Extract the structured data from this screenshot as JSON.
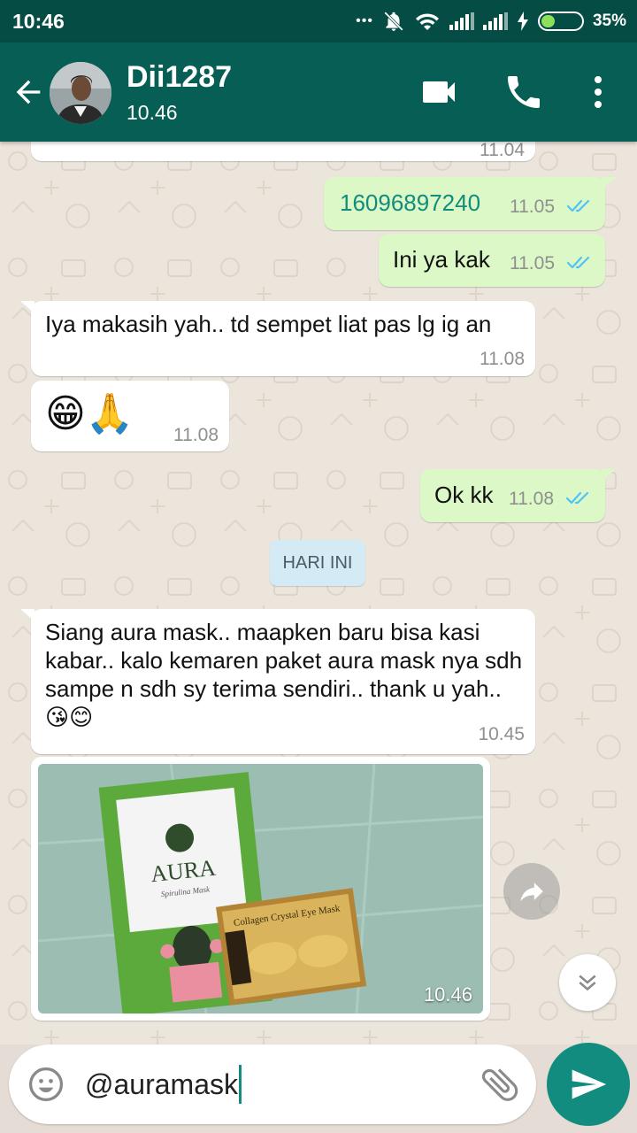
{
  "status_bar": {
    "time": "10:46",
    "dots": "•••",
    "battery_percent": "35%",
    "battery_level": 0.35
  },
  "header": {
    "contact_name": "Dii1287",
    "contact_status": "10.46",
    "icons": [
      "back-arrow-icon",
      "avatar",
      "video-call-icon",
      "phone-icon",
      "more-vert-icon"
    ]
  },
  "chat": {
    "partial_message_time": "11.04",
    "messages": [
      {
        "direction": "out",
        "text": "16096897240",
        "time": "11.05",
        "status": "read"
      },
      {
        "direction": "out",
        "text": "Ini ya kak",
        "time": "11.05",
        "status": "read"
      },
      {
        "direction": "in",
        "text": "Iya makasih yah.. td sempet liat pas lg ig an",
        "time": "11.08"
      },
      {
        "direction": "in",
        "text": "😁🙏",
        "time": "11.08"
      },
      {
        "direction": "out",
        "text": "Ok kk",
        "time": "11.08",
        "status": "read"
      },
      {
        "direction": "in",
        "text": "Siang aura mask.. maapken baru bisa kasi kabar.. kalo kemaren paket aura mask nya sdh sampe n sdh sy terima sendiri.. thank u yah.. 😘😊",
        "time": "10.45"
      },
      {
        "direction": "in",
        "type": "image",
        "time": "10.46"
      }
    ],
    "day_separator": "HARI INI",
    "photo": {
      "pack_brand": "AURA",
      "pack_tagline": "Spirulina Mask",
      "eye_mask_label": "Collagen Crystal Eye Mask"
    }
  },
  "composer": {
    "input_value": "@auramask",
    "icons": [
      "emoji-icon",
      "attach-icon",
      "send-icon"
    ]
  },
  "colors": {
    "status_bar": "#054d44",
    "header": "#075e54",
    "outgoing_bubble": "#dcf8c6",
    "incoming_bubble": "#ffffff",
    "read_ticks": "#4fc3f7",
    "send_button": "#128c7e",
    "link": "#128c7e"
  }
}
